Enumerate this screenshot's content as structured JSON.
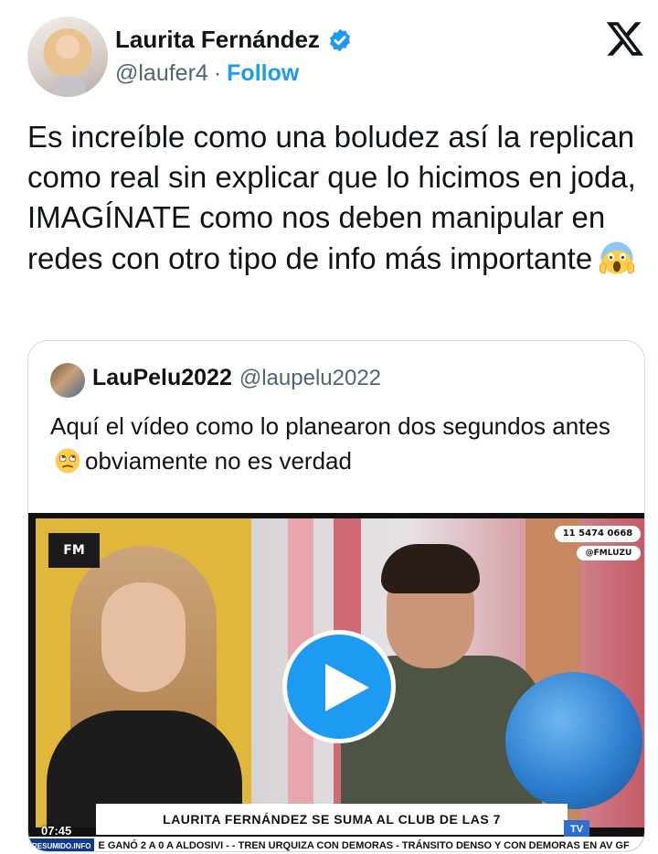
{
  "author": {
    "display_name": "Laurita Fernández",
    "handle": "@laufer4",
    "separator": "·",
    "follow_label": "Follow"
  },
  "tweet": {
    "text": "Es increíble como una boludez así la replican como real sin explicar que lo hicimos en joda, IMAGÍNATE como nos deben manipular en redes con otro tipo de info más importante",
    "emoji": "face-screaming-in-fear"
  },
  "quoted": {
    "display_name": "LauPelu2022",
    "handle": "@laupelu2022",
    "text_before_emoji": "Aquí el vídeo como lo planearon dos segundos antes",
    "emoji": "face-with-rolling-eyes",
    "text_after_emoji": "obviamente no es verdad"
  },
  "video": {
    "logo_text": "FM",
    "phone": "11 5474 0668",
    "social": "@FMLUZU",
    "lower_third": "LAURITA FERNÁNDEZ SE SUMA AL CLUB DE LAS 7",
    "timestamp": "07:45",
    "channel_badge": "TV",
    "ticker_source": "RESUMIDO.INFO",
    "ticker_text": "E GANÓ 2 A 0 A ALDOSIVI  -  - TREN URQUIZA CON DEMORAS  - TRÁNSITO DENSO Y CON DEMORAS EN AV GF"
  },
  "colors": {
    "accent": "#1d9bf0",
    "text_primary": "#0f1419",
    "text_secondary": "#536471",
    "border": "#cfd9de"
  }
}
